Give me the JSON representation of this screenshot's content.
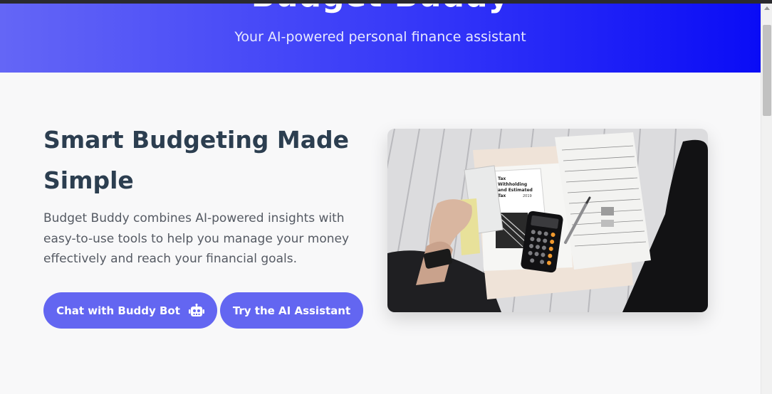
{
  "header": {
    "title": "Budget Buddy",
    "subtitle": "Your AI-powered personal finance assistant"
  },
  "hero": {
    "headline_line1": "Smart Budgeting Made",
    "headline_line2": "Simple",
    "description": "Budget Buddy combines AI-powered insights with easy-to-use tools to help you manage your money effectively and reach your financial goals.",
    "chat_button_label": "Chat with Buddy Bot",
    "chat_button_icon": "robot-icon",
    "assistant_button_label": "Try the AI Assistant"
  },
  "photo": {
    "form_heading_line1": "Tax",
    "form_heading_line2": "Withholding",
    "form_heading_line3": "and Estimated",
    "form_heading_line4": "Tax",
    "form_year": "2019"
  },
  "colors": {
    "accent": "#6366f1",
    "header_gradient_start": "#6466f6",
    "header_gradient_end": "#0a0cf6",
    "headline": "#2c3e50",
    "body_text": "#555a63"
  }
}
